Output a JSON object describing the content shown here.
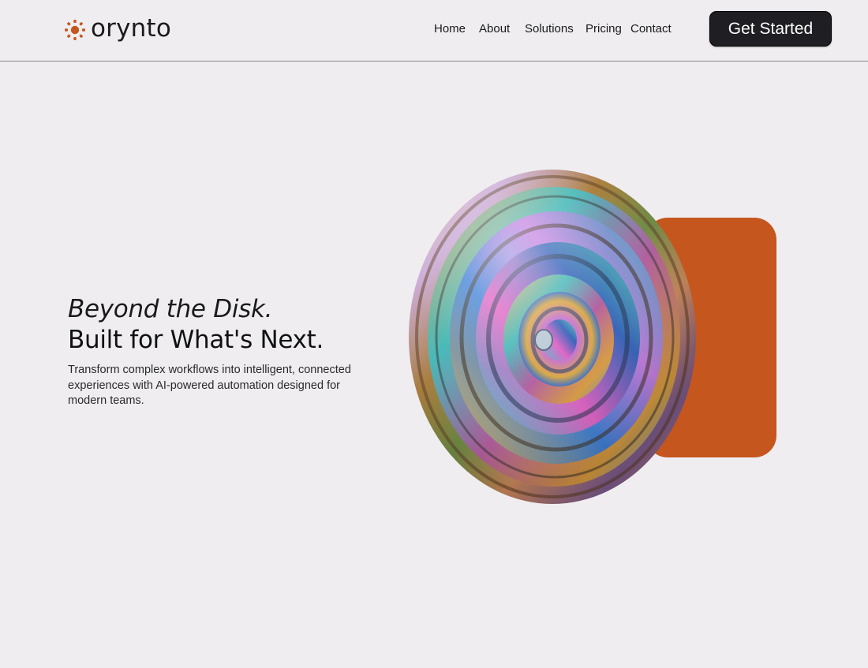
{
  "brand": {
    "name": "orynto",
    "accent_color": "#c5561d",
    "icon": "sun-dots-icon"
  },
  "nav": {
    "items": [
      {
        "label": "Home"
      },
      {
        "label": "About"
      },
      {
        "label": "Solutions"
      },
      {
        "label": "Pricing"
      },
      {
        "label": "Contact"
      }
    ]
  },
  "header": {
    "cta_label": "Get Started",
    "cta_color": "#1f1e22"
  },
  "hero": {
    "headline_italic": "Beyond the Disk.",
    "headline_bold": "Built for What's Next.",
    "description": "Transform complex workflows into intelligent, connected experiences with AI-powered automation designed for modern teams."
  },
  "colors": {
    "background": "#efedf0",
    "text": "#1a1a1c"
  }
}
